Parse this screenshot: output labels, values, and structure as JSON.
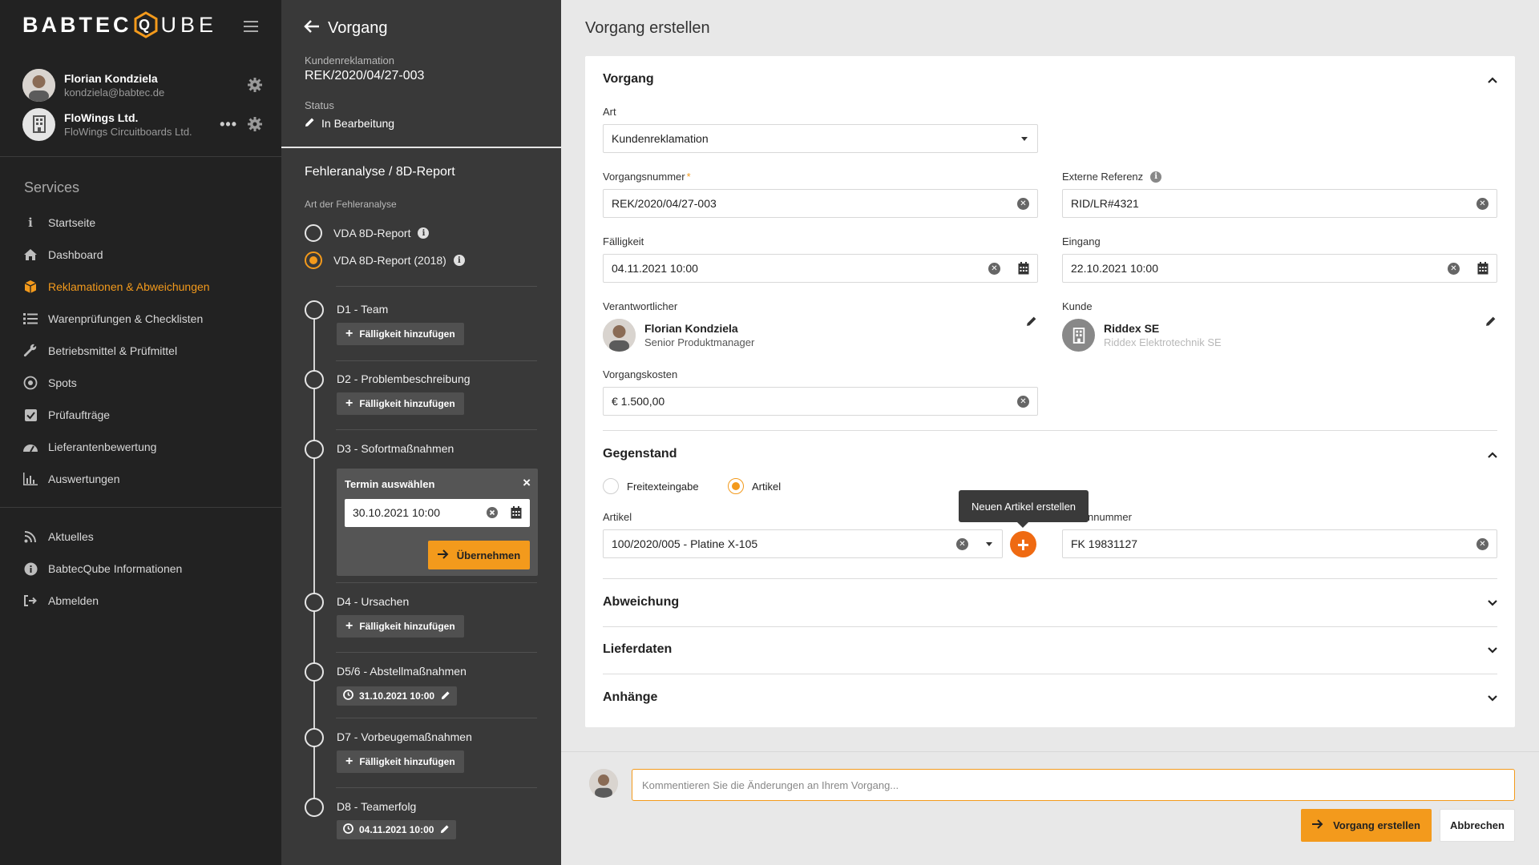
{
  "sidebar": {
    "logo_left": "BABTEC",
    "logo_right": "UBE",
    "user": {
      "name": "Florian Kondziela",
      "email": "kondziela@babtec.de"
    },
    "org": {
      "name": "FloWings Ltd.",
      "sub": "FloWings Circuitboards Ltd."
    },
    "services_title": "Services",
    "items": [
      {
        "label": "Startseite",
        "icon": "info-icon"
      },
      {
        "label": "Dashboard",
        "icon": "home-icon"
      },
      {
        "label": "Reklamationen & Abweichungen",
        "icon": "boxes-icon",
        "active": true
      },
      {
        "label": "Warenprüfungen & Checklisten",
        "icon": "checklist-icon"
      },
      {
        "label": "Betriebsmittel & Prüfmittel",
        "icon": "wrench-icon"
      },
      {
        "label": "Spots",
        "icon": "target-icon"
      },
      {
        "label": "Prüfaufträge",
        "icon": "checkbox-icon"
      },
      {
        "label": "Lieferantenbewertung",
        "icon": "gauge-icon"
      },
      {
        "label": "Auswertungen",
        "icon": "bar-chart-icon"
      }
    ],
    "items2": [
      {
        "label": "Aktuelles",
        "icon": "rss-icon"
      },
      {
        "label": "BabtecQube Informationen",
        "icon": "info-circle-icon"
      },
      {
        "label": "Abmelden",
        "icon": "logout-icon"
      }
    ]
  },
  "middle": {
    "back_label": "Vorgang",
    "type_label": "Kundenreklamation",
    "type_value": "REK/2020/04/27-003",
    "status_label": "Status",
    "status_value": "In Bearbeitung",
    "section_title": "Fehleranalyse / 8D-Report",
    "analysis_label": "Art der Fehleranalyse",
    "radio1": "VDA 8D-Report",
    "radio2": "VDA 8D-Report (2018)",
    "steps": {
      "d1": "D1 - Team",
      "d2": "D2 - Problembeschreibung",
      "d3": "D3 - Sofortmaßnahmen",
      "d4": "D4 - Ursachen",
      "d56": "D5/6 - Abstellmaßnahmen",
      "d7": "D7 - Vorbeugemaßnahmen",
      "d8": "D8 - Teamerfolg"
    },
    "add_due": "Fälligkeit hinzufügen",
    "termin_title": "Termin auswählen",
    "termin_value": "30.10.2021 10:00",
    "termin_btn": "Übernehmen",
    "d56_date": "31.10.2021 10:00",
    "d8_date": "04.11.2021 10:00"
  },
  "main": {
    "title": "Vorgang erstellen",
    "sec_vorgang": "Vorgang",
    "art_label": "Art",
    "art_value": "Kundenreklamation",
    "nr_label": "Vorgangsnummer",
    "nr_value": "REK/2020/04/27-003",
    "ext_label": "Externe Referenz",
    "ext_value": "RID/LR#4321",
    "due_label": "Fälligkeit",
    "due_value": "04.11.2021 10:00",
    "in_label": "Eingang",
    "in_value": "22.10.2021 10:00",
    "resp_label": "Verantwortlicher",
    "resp_name": "Florian Kondziela",
    "resp_role": "Senior Produktmanager",
    "cust_label": "Kunde",
    "cust_name": "Riddex SE",
    "cust_sub": "Riddex Elektrotechnik SE",
    "cost_label": "Vorgangskosten",
    "cost_value": "€ 1.500,00",
    "sec_gegenstand": "Gegenstand",
    "opt_free": "Freitexteingabe",
    "opt_article": "Artikel",
    "article_label": "Artikel",
    "article_value": "100/2020/005 - Platine X-105",
    "tooltip": "Neuen Artikel erstellen",
    "serial_label": "nnummer",
    "serial_value": "FK 19831127",
    "sec_abweichung": "Abweichung",
    "sec_liefer": "Lieferdaten",
    "sec_anhaenge": "Anhänge"
  },
  "footer": {
    "comment_placeholder": "Kommentieren Sie die Änderungen an Ihrem Vorgang...",
    "create_btn": "Vorgang erstellen",
    "cancel_btn": "Abbrechen"
  },
  "colors": {
    "accent": "#f39a1c",
    "add": "#ef6a12",
    "sidebar": "#222222",
    "middle": "#393939"
  }
}
